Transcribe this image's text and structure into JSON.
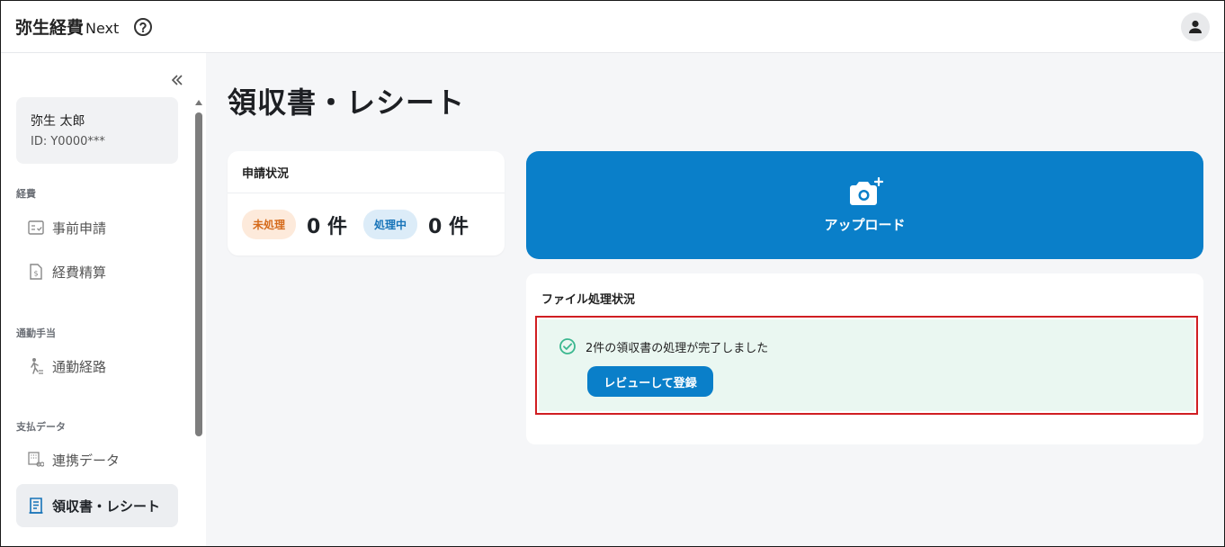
{
  "header": {
    "app_title": "弥生経費",
    "app_title_suffix": "Next",
    "help_icon": "help-circle-icon",
    "avatar_icon": "person-icon"
  },
  "sidebar": {
    "collapse_icon": "chevrons-left-icon",
    "user": {
      "name": "弥生 太郎",
      "id": "ID: Y0000***"
    },
    "sections": [
      {
        "label": "経費",
        "items": [
          {
            "label": "事前申請",
            "icon": "pre-application-icon",
            "active": false
          },
          {
            "label": "経費精算",
            "icon": "expense-document-icon",
            "active": false
          }
        ]
      },
      {
        "label": "通勤手当",
        "items": [
          {
            "label": "通勤経路",
            "icon": "walking-person-icon",
            "active": false
          }
        ]
      },
      {
        "label": "支払データ",
        "items": [
          {
            "label": "連携データ",
            "icon": "linked-data-icon",
            "active": false
          },
          {
            "label": "領収書・レシート",
            "icon": "receipt-icon",
            "active": true
          }
        ]
      }
    ]
  },
  "main": {
    "page_title": "領収書・レシート",
    "status_card": {
      "title": "申請状況",
      "pending_label": "未処理",
      "pending_count": "0 件",
      "processing_label": "処理中",
      "processing_count": "0 件"
    },
    "upload": {
      "label": "アップロード",
      "icon": "camera-plus-icon"
    },
    "file_status": {
      "title": "ファイル処理状況",
      "message": "2件の領収書の処理が完了しました",
      "check_icon": "check-circle-icon",
      "review_button": "レビューして登録"
    }
  },
  "colors": {
    "primary": "#0a7fc9",
    "pending_badge_bg": "#fdeadb",
    "pending_badge_text": "#d56a1a",
    "processing_badge_bg": "#dcecf8",
    "processing_badge_text": "#1673b8",
    "success_bg": "#eaf7f1",
    "success_icon": "#3bb78f",
    "highlight_border": "#d01e22"
  }
}
